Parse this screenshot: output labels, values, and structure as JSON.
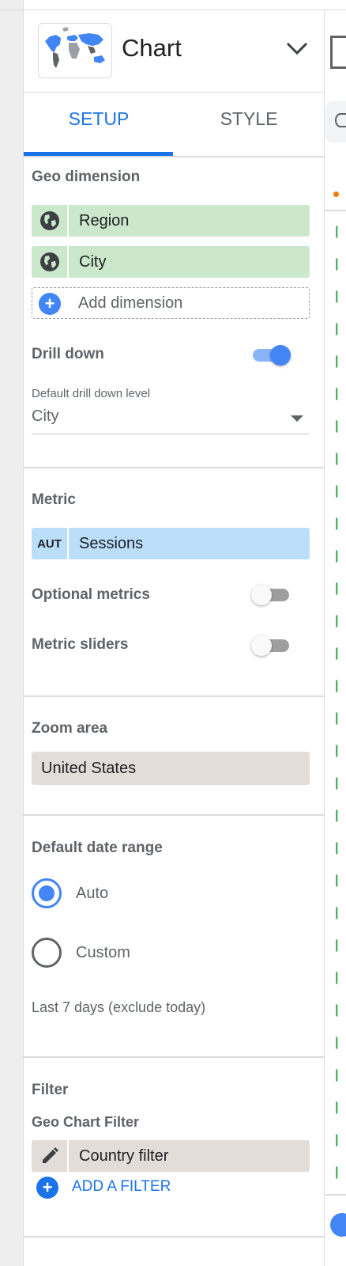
{
  "header": {
    "title": "Chart"
  },
  "tabs": {
    "setup": "SETUP",
    "style": "STYLE"
  },
  "geo_dimension": {
    "title": "Geo dimension",
    "items": [
      {
        "label": "Region",
        "icon": "globe-icon"
      },
      {
        "label": "City",
        "icon": "globe-icon"
      }
    ],
    "add_label": "Add dimension"
  },
  "drill_down": {
    "title": "Drill down",
    "enabled": true,
    "default_level_label": "Default drill down level",
    "default_level_value": "City"
  },
  "metric": {
    "title": "Metric",
    "items": [
      {
        "badge": "AUT",
        "label": "Sessions"
      }
    ],
    "optional_metrics_label": "Optional metrics",
    "optional_metrics_enabled": false,
    "metric_sliders_label": "Metric sliders",
    "metric_sliders_enabled": false
  },
  "zoom": {
    "title": "Zoom area",
    "value": "United States"
  },
  "date_range": {
    "title": "Default date range",
    "options": [
      "Auto",
      "Custom"
    ],
    "selected": "Auto",
    "note": "Last 7 days (exclude today)"
  },
  "filter": {
    "title": "Filter",
    "subtitle": "Geo Chart Filter",
    "items": [
      {
        "label": "Country filter",
        "icon": "pencil-icon"
      }
    ],
    "add_label": "ADD A FILTER"
  },
  "colors": {
    "accent": "#1a73e8",
    "toggle_on": "#4285f4",
    "dimension_chip": "#cce8cc",
    "metric_chip": "#bbdefb",
    "neutral_chip": "#e2ddd9"
  }
}
